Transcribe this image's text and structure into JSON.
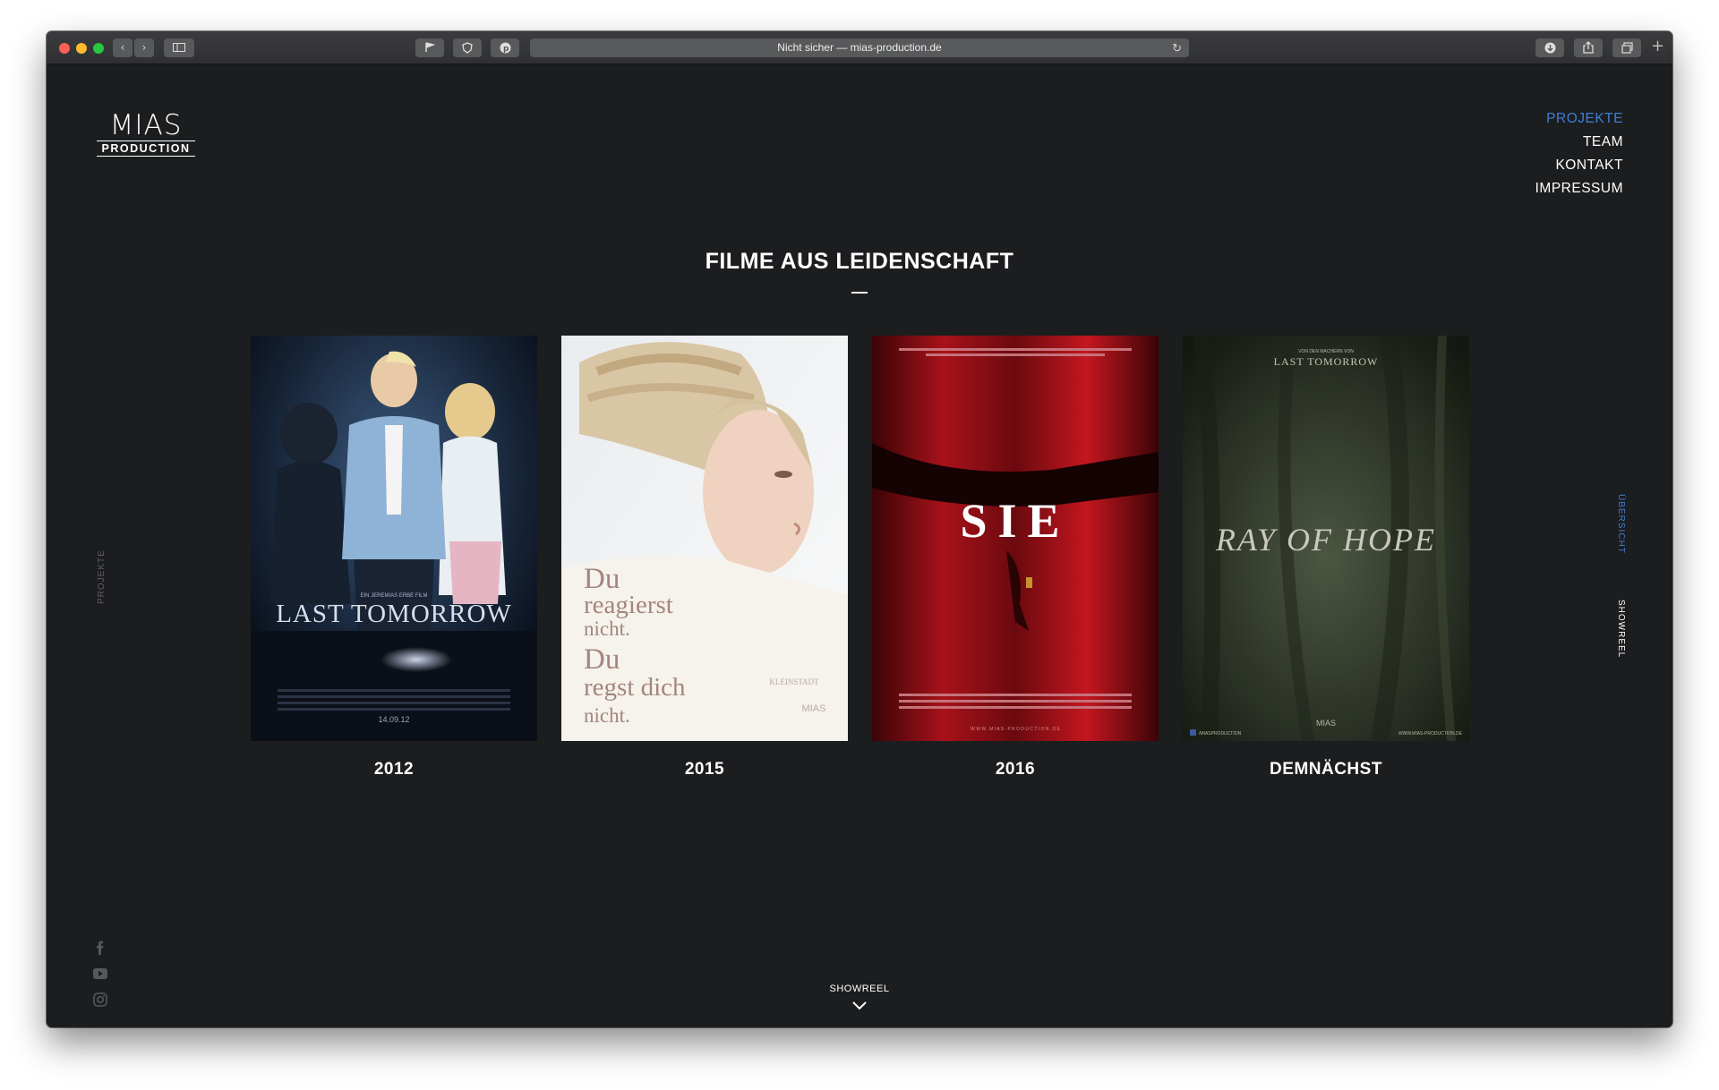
{
  "browser": {
    "url_text": "Nicht sicher — mias-production.de",
    "colors": {
      "toolbar": "#2f3032",
      "close": "#fe5f57",
      "minimize": "#febc2e",
      "maximize": "#28c840"
    }
  },
  "site": {
    "logo": {
      "line1": "MIAS",
      "line2": "PRODUCTION"
    },
    "nav": [
      "PROJEKTE",
      "TEAM",
      "KONTAKT",
      "IMPRESSUM"
    ],
    "nav_active": "PROJEKTE",
    "heading": "FILME AUS LEIDENSCHAFT",
    "side_left": "PROJEKTE",
    "side_right": [
      "ÜBERSICHT",
      "SHOWREEL"
    ],
    "showreel": "SHOWREEL",
    "accent": "#3d7fd3",
    "background": "#1c1d1f"
  },
  "posters": [
    {
      "year": "2012",
      "title": "LAST TOMORROW",
      "tagline": "EIN JEREMIAS ERBE FILM",
      "date": "14.09.12"
    },
    {
      "year": "2015",
      "lines": [
        "Du",
        "reagierst",
        "nicht.",
        "Du",
        "regst dich",
        "nicht."
      ],
      "sub": "KLEINSTADT",
      "logo": "MIAS"
    },
    {
      "year": "2016",
      "title": "SIE",
      "footer": "W W W . M I A S - P R O D U C T I O N . D E"
    },
    {
      "year": "DEMNÄCHST",
      "top_small": "VON DEN MACHERN VON",
      "top": "LAST TOMORROW",
      "title": "RAY OF HOPE",
      "footer_left": "/MIASPRODUCTION",
      "footer_right": "WWW.MIAS-PRODUCTION.DE",
      "logo": "MIAS"
    }
  ]
}
